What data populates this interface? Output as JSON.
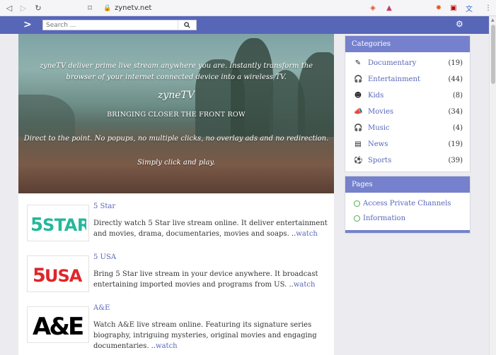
{
  "browser": {
    "url": "zynetv.net",
    "back_icon": "back-arrow-icon",
    "forward_icon": "forward-arrow-icon",
    "reload_icon": "reload-icon",
    "bookmark_icon": "bookmark-icon",
    "extensions": [
      {
        "name": "brave-shield-icon",
        "glyph": "◈",
        "color": "#e0502b"
      },
      {
        "name": "brave-rewards-icon",
        "glyph": "▲",
        "color": "#c33a6e"
      },
      {
        "name": "fire-icon",
        "glyph": "✹",
        "color": "#e65b1a"
      },
      {
        "name": "pdf-icon",
        "glyph": "⬛",
        "color": "#b30000"
      },
      {
        "name": "translate-icon",
        "glyph": "文",
        "color": "#3c6fd0"
      },
      {
        "name": "menu-icon",
        "glyph": "⋮",
        "color": "#555555"
      }
    ]
  },
  "site": {
    "brand_color": "#5866b8",
    "search_placeholder": "Search ...",
    "logo_icon": "chevron-right-icon",
    "settings_icon": "gear-icon"
  },
  "hero": {
    "intro": "zyneTV deliver prime live stream anywhere you are. Instantly transform the browser of your internet connected device into a wireless TV.",
    "title": "zyneTV",
    "tagline": "BRINGING CLOSER THE FRONT ROW",
    "point": "Direct to the point. No popups, no multiple clicks, no overlay ads and no redirection.",
    "cta": "Simply click and play."
  },
  "channels": [
    {
      "name": "5 Star",
      "desc": "Directly watch 5 Star live stream online. It deliver entertainment and movies, drama, documentaries, movies and soaps. ..",
      "watch": "watch",
      "logo": "5STAR"
    },
    {
      "name": "5 USA",
      "desc": "Bring 5 Star live stream in your device anywhere. It broadcast entertaining imported movies and programs from US. ..",
      "watch": "watch",
      "logo": "5USA"
    },
    {
      "name": "A&E",
      "desc": "Watch A&E live stream online. Featuring its signature series biography, intriguing mysteries, original movies and engaging documentaries. ..",
      "watch": "watch",
      "logo": "A&E"
    }
  ],
  "sidebar": {
    "categories_title": "Categories",
    "categories": [
      {
        "label": "Documentary",
        "count": "(19)",
        "icon": "pencil-icon",
        "glyph": "✎"
      },
      {
        "label": "Entertainment",
        "count": "(44)",
        "icon": "headphones-icon",
        "glyph": "🎧"
      },
      {
        "label": "Kids",
        "count": "(8)",
        "icon": "child-face-icon",
        "glyph": "☻"
      },
      {
        "label": "Movies",
        "count": "(34)",
        "icon": "megaphone-icon",
        "glyph": "📣"
      },
      {
        "label": "Music",
        "count": "(4)",
        "icon": "headphones-icon",
        "glyph": "🎧"
      },
      {
        "label": "News",
        "count": "(19)",
        "icon": "newspaper-icon",
        "glyph": "▤"
      },
      {
        "label": "Sports",
        "count": "(39)",
        "icon": "soccer-ball-icon",
        "glyph": "⚽"
      }
    ],
    "pages_title": "Pages",
    "pages": [
      {
        "label": "Access Private Channels"
      },
      {
        "label": "Information"
      }
    ]
  }
}
